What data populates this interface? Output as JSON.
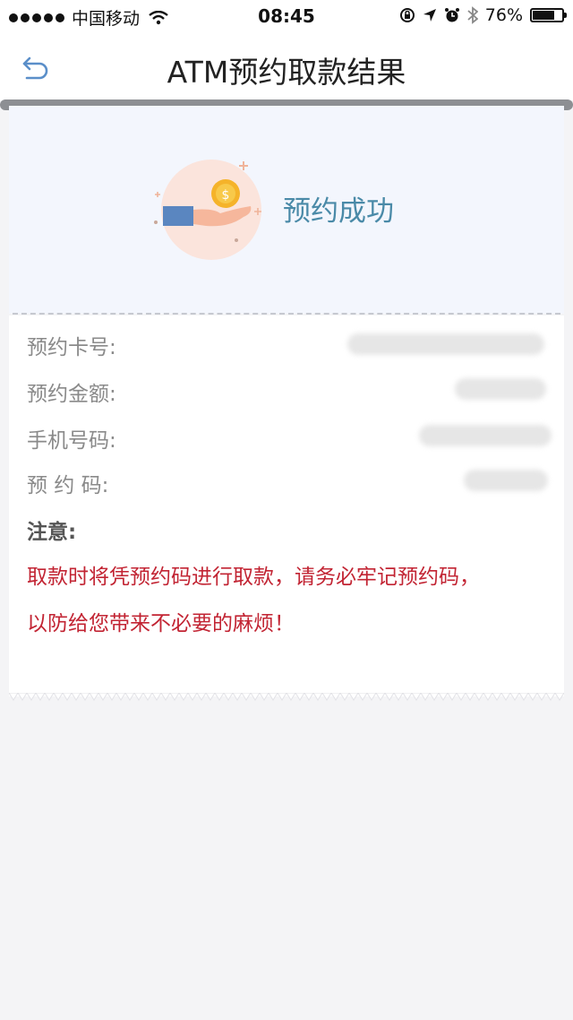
{
  "status_bar": {
    "carrier": "中国移动",
    "time": "08:45",
    "battery": "76%",
    "battery_level": 0.76
  },
  "nav": {
    "title": "ATM预约取款结果"
  },
  "result": {
    "status_text": "预约成功"
  },
  "details": {
    "card_label": "预约卡号:",
    "amount_label": "预约金额:",
    "phone_label": "手机号码:",
    "code_label": "预 约 码:"
  },
  "notice": {
    "title": "注意:",
    "line1": "取款时将凭预约码进行取款，请务必牢记预约码，",
    "line2": "以防给您带来不必要的麻烦！"
  },
  "colors": {
    "accent": "#4a8aa8",
    "warning": "#c22433"
  },
  "icons": {
    "back": "back-arrow-icon",
    "success": "coin-in-hand-icon"
  }
}
